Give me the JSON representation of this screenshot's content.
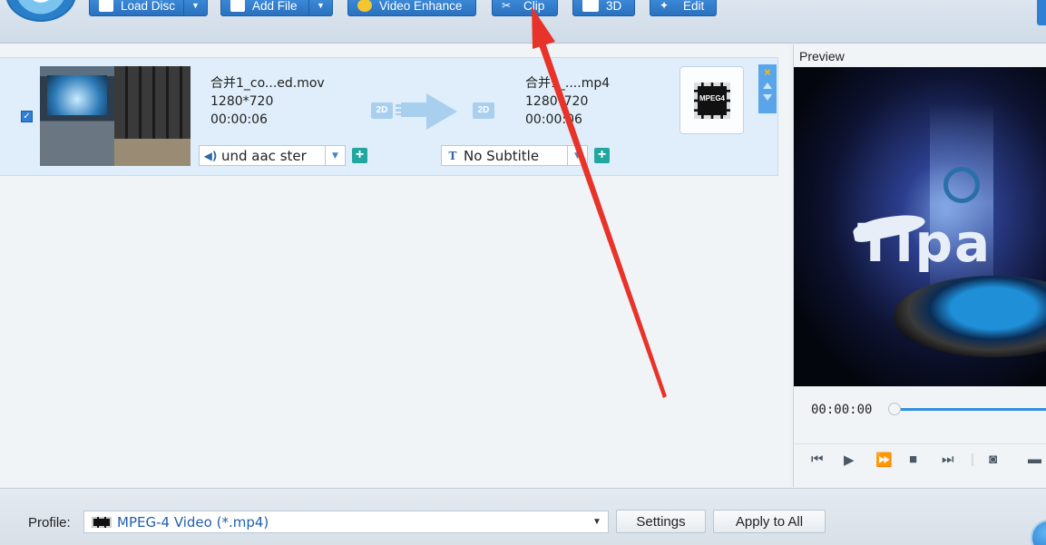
{
  "toolbar": {
    "load_disc": "Load Disc",
    "add_file": "Add File",
    "video_enhance": "Video Enhance",
    "clip": "Clip",
    "three_d": "3D",
    "edit": "Edit"
  },
  "file_item": {
    "checked": true,
    "source": {
      "name": "合并1_co...ed.mov",
      "resolution": "1280*720",
      "duration": "00:00:06"
    },
    "conversion": {
      "from_badge": "2D",
      "to_badge": "2D"
    },
    "output": {
      "name": "合并1_....mp4",
      "resolution": "1280*720",
      "duration": "00:00:06"
    },
    "format_label": "MPEG4",
    "audio_track": "und aac ster",
    "subtitle": "No Subtitle"
  },
  "preview": {
    "title": "Preview",
    "brand_text": "Tipa",
    "time": "00:00:00"
  },
  "footer": {
    "profile_label": "Profile:",
    "profile_icon_text": "MPEG",
    "profile_value": "MPEG-4 Video (*.mp4)",
    "settings_label": "Settings",
    "apply_all_label": "Apply to All"
  },
  "colors": {
    "accent": "#2f80d4",
    "annotation": "#e8332a",
    "row_selected": "#dfeefa"
  }
}
